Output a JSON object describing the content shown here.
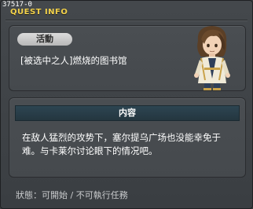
{
  "quest_id": "37517-0",
  "window": {
    "title": "QUEST INFO"
  },
  "header": {
    "category_label": "活動",
    "quest_name": "[被选中之人]燃烧的图书馆"
  },
  "content": {
    "header_label": "内容",
    "description": "在敌人猛烈的攻势下，塞尔提乌广场也没能幸免于难。与卡莱尔讨论眼下的情况吧。"
  },
  "status": {
    "text": "狀態：可開始 / 不可執行任務"
  },
  "colors": {
    "title_accent": "#f3d24a",
    "panel_bg": "#4a4e52",
    "content_header_bg": "#2d4552",
    "badge_bg": "#c8c8c8"
  }
}
